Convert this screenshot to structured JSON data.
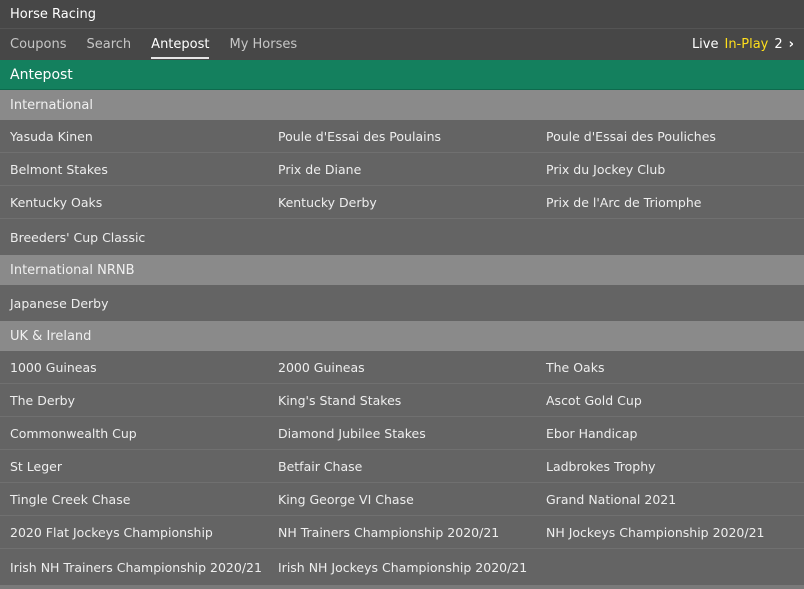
{
  "title": "Horse Racing",
  "nav": {
    "tabs": [
      {
        "label": "Coupons",
        "active": false
      },
      {
        "label": "Search",
        "active": false
      },
      {
        "label": "Antepost",
        "active": true
      },
      {
        "label": "My Horses",
        "active": false
      }
    ],
    "live": {
      "live_label": "Live",
      "inplay_label": "In-Play",
      "count": "2",
      "chevron": "›"
    }
  },
  "section": {
    "title": "Antepost"
  },
  "colors": {
    "accent_green": "#14805e",
    "inplay_yellow": "#ffdf1b"
  },
  "groups": [
    {
      "title": "International",
      "rows": [
        [
          "Yasuda Kinen",
          "Poule d'Essai des Poulains",
          "Poule d'Essai des Pouliches"
        ],
        [
          "Belmont Stakes",
          "Prix de Diane",
          "Prix du Jockey Club"
        ],
        [
          "Kentucky Oaks",
          "Kentucky Derby",
          "Prix de l'Arc de Triomphe"
        ],
        [
          "Breeders' Cup Classic",
          "",
          ""
        ]
      ]
    },
    {
      "title": "International NRNB",
      "rows": [
        [
          "Japanese Derby",
          "",
          ""
        ]
      ]
    },
    {
      "title": "UK & Ireland",
      "rows": [
        [
          "1000 Guineas",
          "2000 Guineas",
          "The Oaks"
        ],
        [
          "The Derby",
          "King's Stand Stakes",
          "Ascot Gold Cup"
        ],
        [
          "Commonwealth Cup",
          "Diamond Jubilee Stakes",
          "Ebor Handicap"
        ],
        [
          "St Leger",
          "Betfair Chase",
          "Ladbrokes Trophy"
        ],
        [
          "Tingle Creek Chase",
          "King George VI Chase",
          "Grand National 2021"
        ],
        [
          "2020 Flat Jockeys Championship",
          "NH Trainers Championship 2020/21",
          "NH Jockeys Championship 2020/21"
        ],
        [
          "Irish NH Trainers Championship 2020/21",
          "Irish NH Jockeys Championship 2020/21",
          ""
        ]
      ]
    }
  ]
}
